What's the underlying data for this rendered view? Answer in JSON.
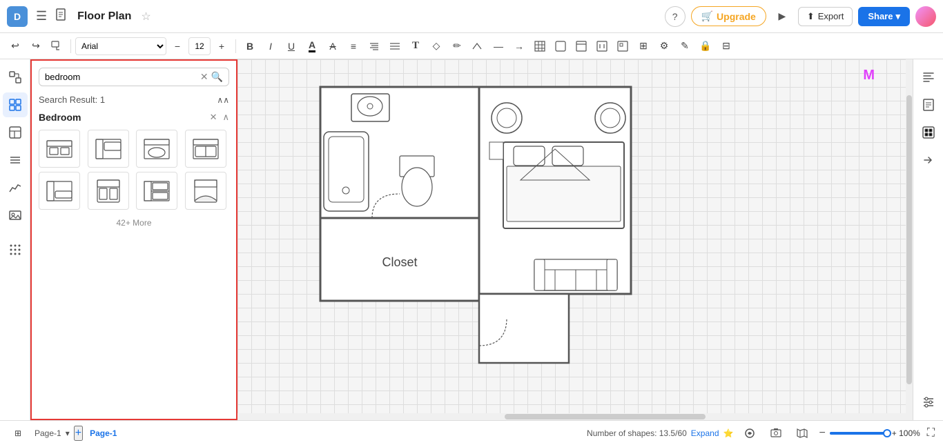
{
  "header": {
    "logo_text": "D",
    "title": "Floor Plan",
    "upgrade_label": "Upgrade",
    "export_label": "Export",
    "share_label": "Share"
  },
  "toolbar": {
    "font_family": "Arial",
    "font_size": "12",
    "bold": "B",
    "italic": "I",
    "underline": "U"
  },
  "search_panel": {
    "search_value": "bedroom",
    "result_label": "Search Result: 1",
    "category_name": "Bedroom",
    "more_label": "42+ More"
  },
  "canvas": {
    "closet_label": "Closet"
  },
  "statusbar": {
    "page_name": "Page-1",
    "active_page": "Page-1",
    "shape_count": "Number of shapes: 13.5/60",
    "expand_label": "Expand",
    "zoom_level": "+ 100%"
  },
  "icons": {
    "menu": "☰",
    "doc": "⬜",
    "star": "☆",
    "help": "?",
    "play": "▶",
    "upload": "⬆",
    "chevron_up": "⌃",
    "close": "✕",
    "search": "🔍",
    "clear": "✕",
    "collapse_up": "∧",
    "zoom_in": "+",
    "zoom_out": "−",
    "fullscreen": "⛶",
    "page_add": "+",
    "page_dropdown": "▾",
    "settings": "⊞",
    "cursor_arrow": "↖",
    "hand": "✥",
    "shapes": "□",
    "layers": "≡",
    "chart": "📈",
    "image_insert": "⊕",
    "grid_dots": "⠿",
    "right_format": "≡",
    "right_grid": "⊞",
    "right_arrow_in": "→",
    "right_lock": "🔒"
  }
}
